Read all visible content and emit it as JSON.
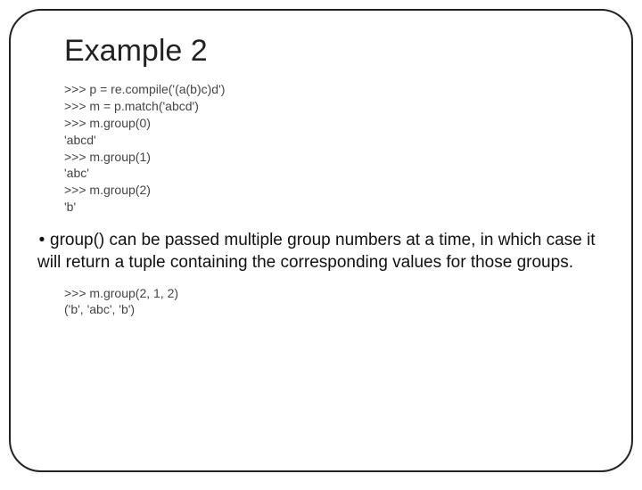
{
  "title": "Example 2",
  "code1": ">>> p = re.compile('(a(b)c)d')\n>>> m = p.match('abcd')\n>>> m.group(0)\n'abcd'\n>>> m.group(1)\n'abc'\n>>> m.group(2)\n'b'",
  "desc_bullet": "•",
  "desc_text": "group() can be passed multiple group numbers at a time, in which case it will return a tuple containing the corresponding values for those groups.",
  "code2": ">>> m.group(2, 1, 2)\n('b', 'abc', 'b')"
}
